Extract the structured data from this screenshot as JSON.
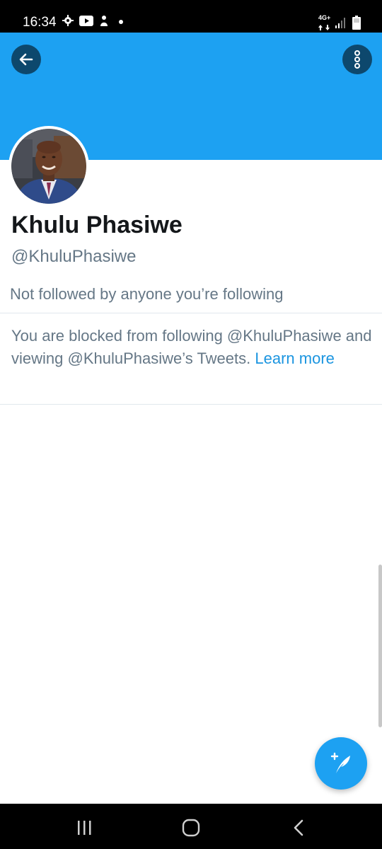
{
  "status_bar": {
    "time": "16:34",
    "network_type": "4G+",
    "icons": [
      "gear-icon",
      "youtube-icon",
      "notification-icon",
      "dot-icon",
      "signal-icon",
      "battery-icon"
    ]
  },
  "header": {
    "background_color": "#1da1f2",
    "back_icon": "arrow-left-icon",
    "more_icon": "more-vertical-icon"
  },
  "profile": {
    "display_name": "Khulu Phasiwe",
    "handle": "@KhuluPhasiwe",
    "follow_context": "Not followed by anyone you’re following"
  },
  "blocked_notice": {
    "text": "You are blocked from following @KhuluPhasiwe and viewing @KhuluPhasiwe’s Tweets. ",
    "link_label": "Learn more"
  },
  "fab": {
    "icon": "compose-tweet-icon"
  },
  "nav_bar": {
    "items": [
      "recents-icon",
      "home-icon",
      "back-icon"
    ]
  }
}
